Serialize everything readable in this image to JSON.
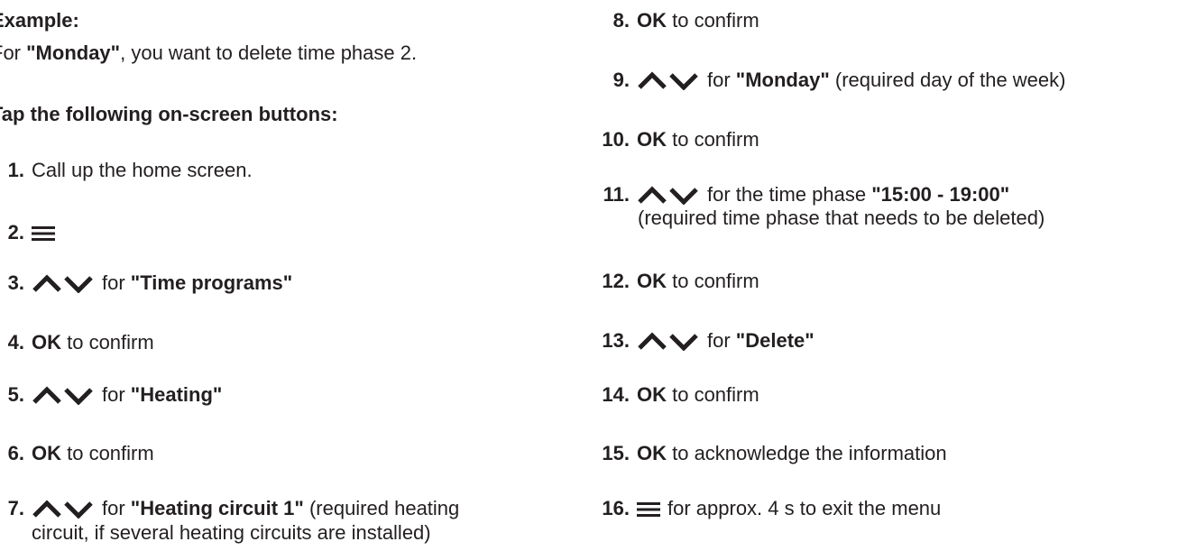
{
  "intro": {
    "example_label": "Example:",
    "desc_pre": "For ",
    "desc_bold": "\"Monday\"",
    "desc_post": ", you want to delete time phase 2.",
    "tap_heading": "Tap the following on-screen buttons:"
  },
  "icons": {
    "arrows": "up-down-arrows-icon",
    "menu": "menu-icon"
  },
  "steps": {
    "s1": {
      "num": "1.",
      "text": "Call up the home screen."
    },
    "s2": {
      "num": "2."
    },
    "s3": {
      "num": "3.",
      "pre": "for ",
      "bold": "\"Time programs\""
    },
    "s4": {
      "num": "4.",
      "bold": "OK",
      "post": " to confirm"
    },
    "s5": {
      "num": "5.",
      "pre": "for ",
      "bold": "\"Heating\""
    },
    "s6": {
      "num": "6.",
      "bold": "OK",
      "post": " to confirm"
    },
    "s7": {
      "num": "7.",
      "pre": "for ",
      "bold": "\"Heating circuit 1\"",
      "post": " (required heating",
      "line2": "circuit, if several heating circuits are installed)"
    },
    "s8": {
      "num": "8.",
      "bold": "OK",
      "post": " to confirm"
    },
    "s9": {
      "num": "9.",
      "pre": "for ",
      "bold": "\"Monday\"",
      "post": " (required day of the week)"
    },
    "s10": {
      "num": "10.",
      "bold": "OK",
      "post": " to confirm"
    },
    "s11": {
      "num": "11.",
      "pre": "for the time phase ",
      "bold": "\"15:00 - 19:00\"",
      "line2": "(required time phase that needs to be deleted)"
    },
    "s12": {
      "num": "12.",
      "bold": "OK",
      "post": " to confirm"
    },
    "s13": {
      "num": "13.",
      "pre": "for ",
      "bold": "\"Delete\""
    },
    "s14": {
      "num": "14.",
      "bold": "OK",
      "post": " to confirm"
    },
    "s15": {
      "num": "15.",
      "bold": "OK",
      "post": " to acknowledge the information"
    },
    "s16": {
      "num": "16.",
      "text": "for approx. 4 s to exit the menu"
    }
  }
}
